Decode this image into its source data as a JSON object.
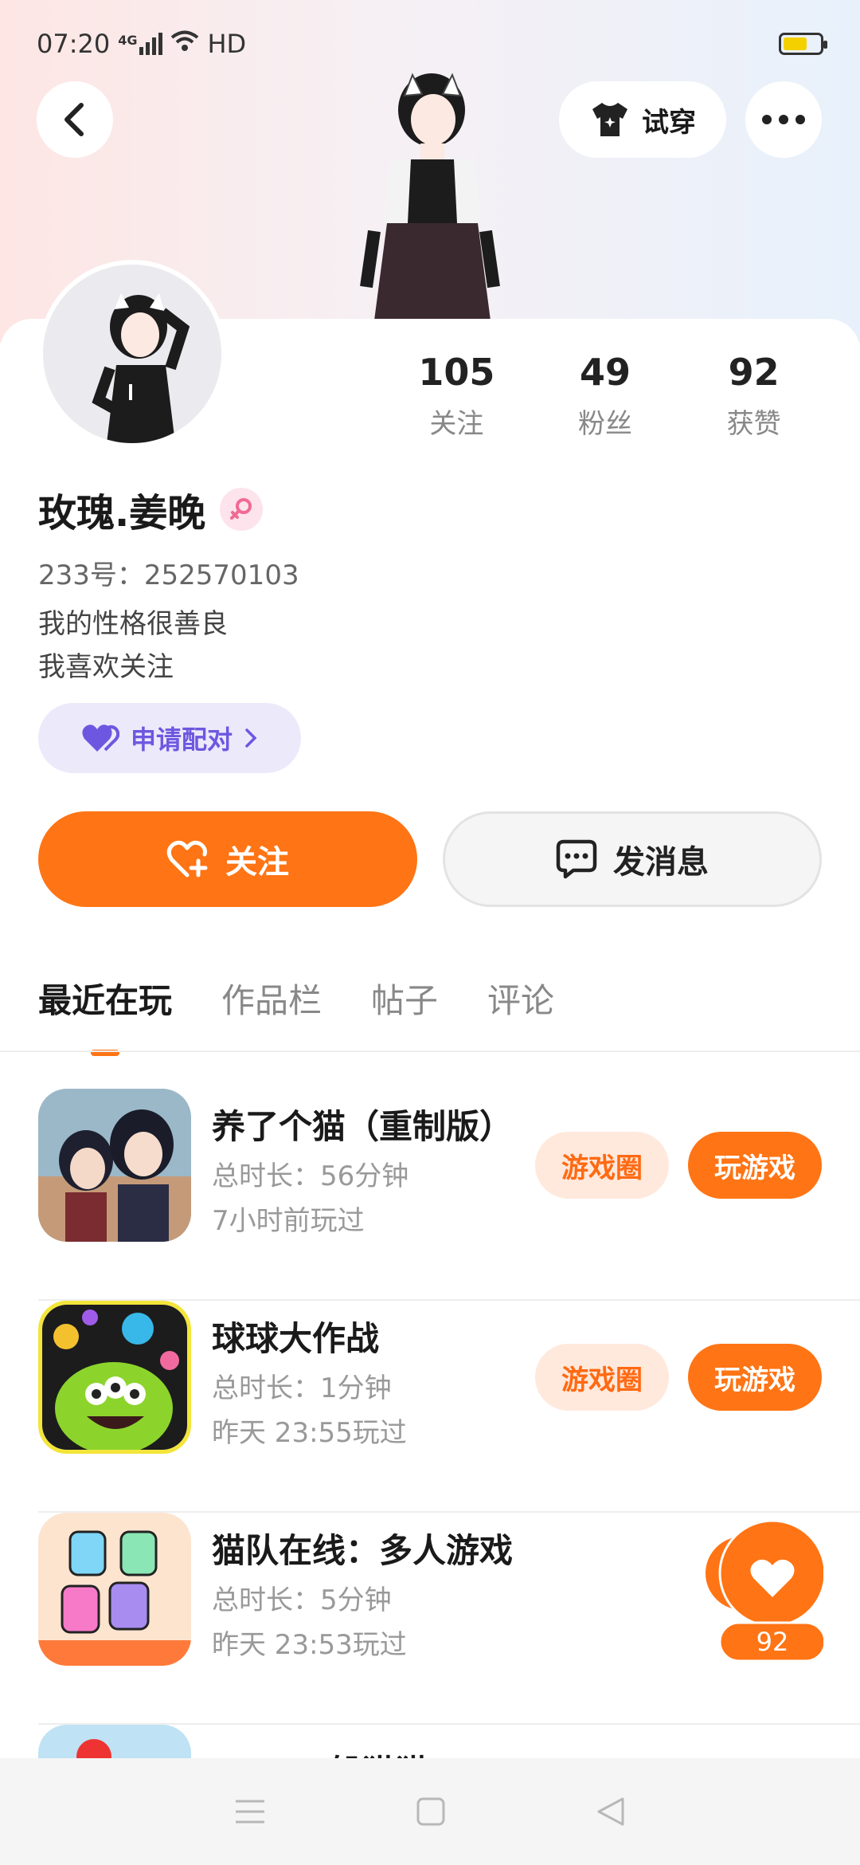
{
  "status_bar": {
    "time": "07:20",
    "network": "4G",
    "wifi_label": "HD"
  },
  "top_actions": {
    "try_on_label": "试穿"
  },
  "profile": {
    "name": "玫瑰.姜晚",
    "uid": "233号：252570103",
    "bio_line1": "我的性格很善良",
    "bio_line2": "我喜欢关注",
    "pair_label": "申请配对"
  },
  "stats": [
    {
      "num": "105",
      "label": "关注"
    },
    {
      "num": "49",
      "label": "粉丝"
    },
    {
      "num": "92",
      "label": "获赞"
    }
  ],
  "actions": {
    "follow_label": "关注",
    "message_label": "发消息"
  },
  "tabs": [
    {
      "label": "最近在玩",
      "active": true
    },
    {
      "label": "作品栏",
      "active": false
    },
    {
      "label": "帖子",
      "active": false
    },
    {
      "label": "评论",
      "active": false
    }
  ],
  "games": [
    {
      "title": "养了个猫（重制版）",
      "duration": "总时长：56分钟",
      "last_played": "7小时前玩过",
      "circle_label": "游戏圈",
      "play_label": "玩游戏"
    },
    {
      "title": "球球大作战",
      "duration": "总时长：1分钟",
      "last_played": "昨天 23:55玩过",
      "circle_label": "游戏圈",
      "play_label": "玩游戏"
    },
    {
      "title": "猫队在线：多人游戏",
      "duration": "总时长：5分钟",
      "last_played": "昨天 23:53玩过"
    },
    {
      "title": "GMOD躲猫猫"
    }
  ],
  "float_like": {
    "count": "92"
  },
  "colors": {
    "accent": "#ff7414",
    "pair": "#6e57e0"
  },
  "icons": [
    "back-icon",
    "tshirt-icon",
    "more-icon",
    "female-icon",
    "heart-icon",
    "chevron-right-icon",
    "heart-plus-icon",
    "chat-icon",
    "menu-icon",
    "home-icon",
    "back-nav-icon"
  ]
}
